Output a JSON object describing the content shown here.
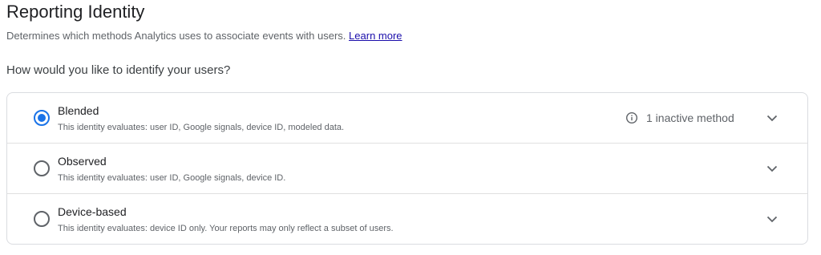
{
  "header": {
    "title": "Reporting Identity",
    "subtitle": "Determines which methods Analytics uses to associate events with users.",
    "learn_more": "Learn more"
  },
  "question": "How would you like to identify your users?",
  "options": [
    {
      "label": "Blended",
      "description": "This identity evaluates: user ID, Google signals, device ID, modeled data.",
      "selected": true,
      "status_text": "1 inactive method",
      "status_icon": "info-icon",
      "expand_icon": "chevron-down-icon"
    },
    {
      "label": "Observed",
      "description": "This identity evaluates: user ID, Google signals, device ID.",
      "selected": false,
      "expand_icon": "chevron-down-icon"
    },
    {
      "label": "Device-based",
      "description": "This identity evaluates: device ID only. Your reports may only reflect a subset of users.",
      "selected": false,
      "expand_icon": "chevron-down-icon"
    }
  ],
  "colors": {
    "accent": "#1a73e8",
    "link": "#1a0dab",
    "border": "#dadce0",
    "secondary_text": "#5f6368"
  }
}
